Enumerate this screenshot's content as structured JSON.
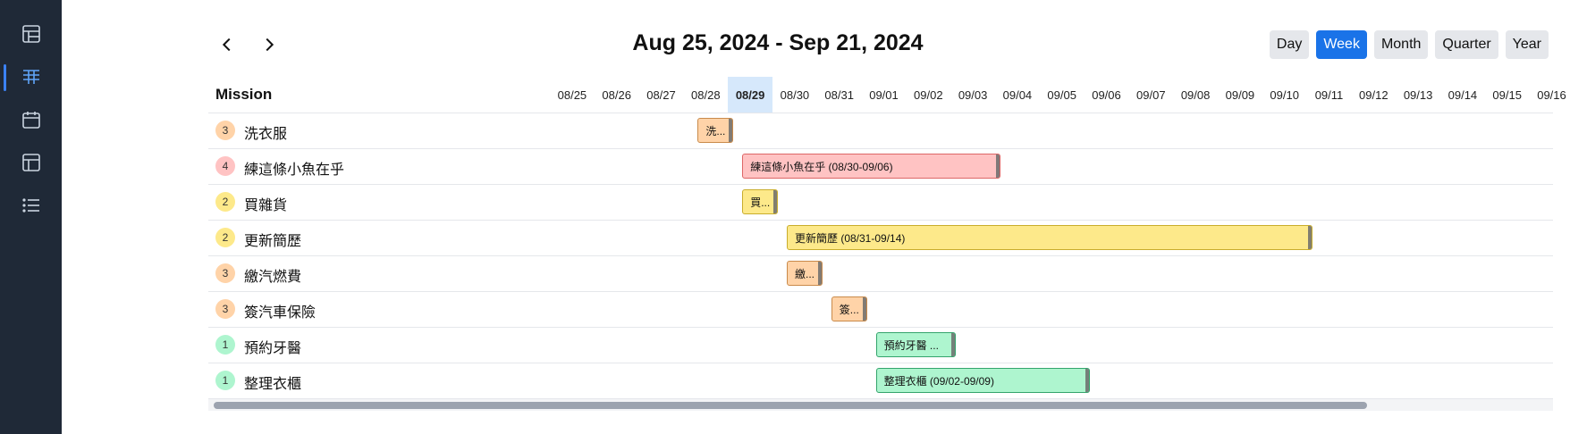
{
  "sidebar": {
    "items": [
      {
        "id": "table",
        "icon": "table-icon",
        "active": false
      },
      {
        "id": "gantt",
        "icon": "gantt-icon",
        "active": true
      },
      {
        "id": "calendar",
        "icon": "calendar-icon",
        "active": false
      },
      {
        "id": "layout",
        "icon": "layout-icon",
        "active": false
      },
      {
        "id": "list",
        "icon": "list-icon",
        "active": false
      }
    ]
  },
  "header": {
    "title": "Aug 25, 2024 - Sep 21, 2024",
    "views": [
      "Day",
      "Week",
      "Month",
      "Quarter",
      "Year"
    ],
    "active_view": "Week"
  },
  "grid": {
    "mission_header": "Mission",
    "dates": [
      "08/25",
      "08/26",
      "08/27",
      "08/28",
      "08/29",
      "08/30",
      "08/31",
      "09/01",
      "09/02",
      "09/03",
      "09/04",
      "09/05",
      "09/06",
      "09/07",
      "09/08",
      "09/09",
      "09/10",
      "09/11",
      "09/12",
      "09/13",
      "09/14",
      "09/15",
      "09/16"
    ],
    "today": "08/29",
    "missions": [
      {
        "priority": "3",
        "name": "洗衣服",
        "bar_label": "洗...",
        "start": "08/28",
        "end": "08/28",
        "color": "orange"
      },
      {
        "priority": "4",
        "name": "練這條小魚在乎",
        "bar_label": "練這條小魚在乎 (08/30-09/06)",
        "start": "08/29",
        "end": "09/03",
        "color": "pink"
      },
      {
        "priority": "2",
        "name": "買雜貨",
        "bar_label": "買...",
        "start": "08/29",
        "end": "08/29",
        "color": "yellow"
      },
      {
        "priority": "2",
        "name": "更新簡歷",
        "bar_label": "更新簡歷 (08/31-09/14)",
        "start": "08/30",
        "end": "09/10",
        "color": "yellow"
      },
      {
        "priority": "3",
        "name": "繳汽燃費",
        "bar_label": "繳...",
        "start": "08/30",
        "end": "08/30",
        "color": "orange"
      },
      {
        "priority": "3",
        "name": "簽汽車保險",
        "bar_label": "簽...",
        "start": "08/31",
        "end": "08/31",
        "color": "orange"
      },
      {
        "priority": "1",
        "name": "預約牙醫",
        "bar_label": "預約牙醫 ...",
        "start": "09/01",
        "end": "09/02",
        "color": "green"
      },
      {
        "priority": "1",
        "name": "整理衣櫃",
        "bar_label": "整理衣櫃 (09/02-09/09)",
        "start": "09/01",
        "end": "09/05",
        "color": "green"
      }
    ]
  },
  "colors": {
    "sidebar_bg": "#1f2937",
    "accent": "#1a73e8",
    "today_bg": "#d6e8fb",
    "priority_1": "#aef5cf",
    "priority_2": "#fde98a",
    "priority_3": "#ffd3a8",
    "priority_4": "#ffc3c3"
  }
}
